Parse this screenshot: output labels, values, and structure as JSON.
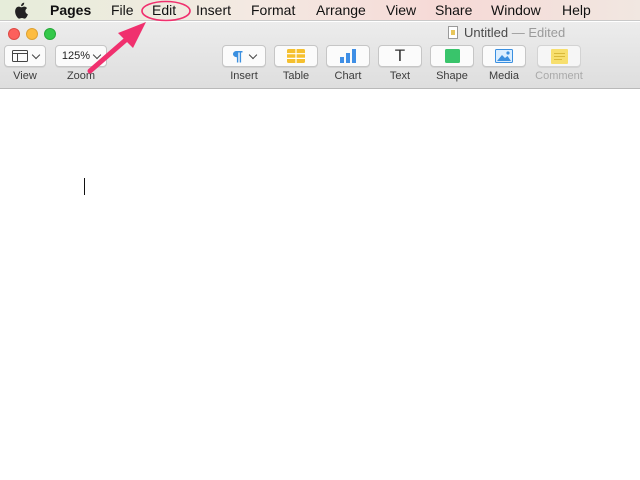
{
  "menubar": {
    "apple_icon": "apple-logo-icon",
    "app_name": "Pages",
    "items": [
      "File",
      "Edit",
      "Insert",
      "Format",
      "Arrange",
      "View",
      "Share",
      "Window",
      "Help"
    ]
  },
  "window": {
    "title": "Untitled",
    "separator": "—",
    "status": "Edited"
  },
  "toolbar": {
    "view_label": "View",
    "zoom_label": "Zoom",
    "zoom_value": "125%",
    "insert_label": "Insert",
    "table_label": "Table",
    "chart_label": "Chart",
    "text_label": "Text",
    "text_glyph": "T",
    "shape_label": "Shape",
    "media_label": "Media",
    "comment_label": "Comment"
  },
  "colors": {
    "accent_table": "#f5c02f",
    "accent_chart": "#3f8fe6",
    "accent_shape": "#39c46b",
    "accent_media": "#3a8fe0",
    "accent_comment": "#f7df6e",
    "annotation": "#f0306e"
  },
  "annotation": {
    "target": "Edit",
    "shape": "ellipse-highlight",
    "arrow": "pointer-arrow"
  }
}
